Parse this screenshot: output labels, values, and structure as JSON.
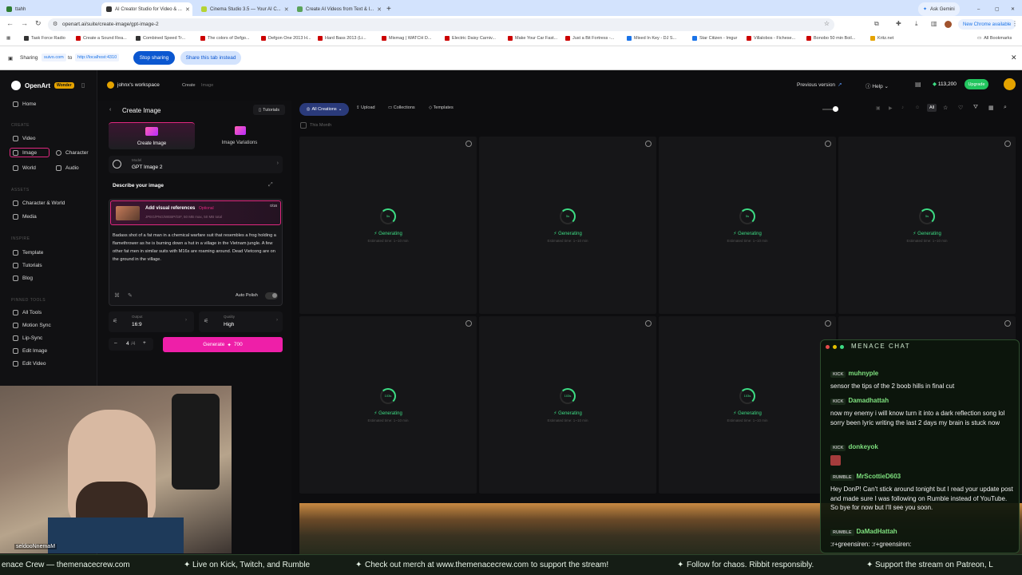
{
  "browser": {
    "tabs": [
      {
        "title": "ttahh",
        "active": false
      },
      {
        "title": "AI Creator Studio for Video & ...",
        "active": true
      },
      {
        "title": "Cinema Studio 3.5 — Your AI C...",
        "active": false
      },
      {
        "title": "Create AI Videos from Text & I...",
        "active": false
      }
    ],
    "ask_gemini": "Ask Gemini",
    "url": "openart.ai/suite/create-image/gpt-image-2",
    "new_chrome": "New Chrome available",
    "bookmarks": [
      "Task Force Radio",
      "Create a Sound Rea...",
      "Combined Speed Tr...",
      "The colors of Defgo...",
      "Defgon One 2013 H...",
      "Hard Bass 2013 (Li...",
      "Mixmag | WATCH D...",
      "Electric Daisy Carniv...",
      "Make Your Car Fast...",
      "Just a Bit Fortress -...",
      "Mixed In Key - DJ S...",
      "Star Citizen - Imgur",
      "Villalobos - Fichese...",
      "Bonobo 50 min Boil...",
      "Kritz.net"
    ],
    "all_bookmarks": "All Bookmarks",
    "sharing": {
      "label": "Sharing",
      "source": "suivo.com",
      "to": "to",
      "target": "http://localhost:4310",
      "stop": "Stop sharing",
      "share_tab": "Share this tab instead"
    }
  },
  "app": {
    "brand": "OpenArt",
    "badge": "Wonder",
    "nav": {
      "home": "Home",
      "create_label": "CREATE",
      "video": "Video",
      "image": "Image",
      "character": "Character",
      "world": "World",
      "audio": "Audio",
      "assets_label": "ASSETS",
      "char_world": "Character & World",
      "media": "Media",
      "inspire_label": "INSPIRE",
      "template": "Template",
      "tutorials": "Tutorials",
      "blog": "Blog",
      "pinned_label": "PINNED TOOLS",
      "all_tools": "All Tools",
      "motion_sync": "Motion Sync",
      "lip_sync": "Lip-Sync",
      "edit_image": "Edit Image",
      "edit_video": "Edit Video"
    },
    "workspace": "johnx's workspace",
    "breadcrumb": [
      "Create",
      "Image"
    ],
    "prev_version": "Previous version",
    "help": "Help",
    "credits": "113,200",
    "upgrade": "Upgrade",
    "panel": {
      "title": "Create Image",
      "tutorials": "Tutorials",
      "mode_create": "Create Image",
      "mode_variations": "Image Variations",
      "model_label": "Model",
      "model_name": "GPT Image 2",
      "describe": "Describe your image",
      "visual_refs": "Add visual references",
      "optional": "Optional",
      "refs_count": "0/16",
      "refs_formats": "JPEG/PNG/WEBP/GIF, 50 MB max, 50 MB total",
      "prompt": "Badass shot of a fat man in a chemical warfare suit that resembles a frog holding a flamethrower as he is burning down a hut in a village in the Vietnam jungle. A few other fat men in similar suits with M16s are roaming around. Dead Vietcong are on the ground in the village.",
      "auto_polish": "Auto Polish",
      "output_label": "Output",
      "output_value": "16:9",
      "quality_label": "Quality",
      "quality_value": "High",
      "count": "4",
      "count_max": "/4",
      "generate": "Generate",
      "generate_cost": "700"
    },
    "filters": {
      "all_creations": "All Creations",
      "upload": "Upload",
      "collections": "Collections",
      "templates": "Templates",
      "all": "All"
    },
    "this_month": "This Month",
    "cards": [
      {
        "timer": "5s",
        "status": "Generating",
        "est": "Estimated time: 1~10 min"
      },
      {
        "timer": "5s",
        "status": "Generating",
        "est": "Estimated time: 1~10 min"
      },
      {
        "timer": "5s",
        "status": "Generating",
        "est": "Estimated time: 1~10 min"
      },
      {
        "timer": "5s",
        "status": "Generating",
        "est": "Estimated time: 1~10 min"
      },
      {
        "timer": "103s",
        "status": "Generating",
        "est": "Estimated time: 1~10 min"
      },
      {
        "timer": "103s",
        "status": "Generating",
        "est": "Estimated time: 1~10 min"
      },
      {
        "timer": "103s",
        "status": "Generating",
        "est": "Estimated time: 1~10 min"
      }
    ]
  },
  "stream": {
    "cam_name": "seldooNnemaM",
    "chat_title": "MENACE CHAT",
    "messages": [
      {
        "platform": "KICK",
        "user": "muhnyple",
        "text": "sensor the tips of the 2 boob hills in final cut"
      },
      {
        "platform": "KICK",
        "user": "Damadhattah",
        "text": "now my enemy i will know turn it into a dark reflection song lol sorry been lyric writing the last 2 days my brain is stuck now"
      },
      {
        "platform": "KICK",
        "user": "donkeyok",
        "text": ""
      },
      {
        "platform": "RUMBLE",
        "user": "MrScottieD603",
        "text": "Hey DonP! Can't stick around tonight but I read your update post and made sure I was following on Rumble instead of YouTube. So bye for now but I'll see you soon."
      },
      {
        "platform": "RUMBLE",
        "user": "DaMadHattah",
        "text": ":r+greensiren: :r+greensiren:"
      }
    ],
    "ticker": [
      "enace Crew — themenacecrew.com",
      "Live on Kick, Twitch, and Rumble",
      "Check out merch at www.themenacecrew.com to support the stream!",
      "Follow for chaos. Ribbit responsibly.",
      "Support the stream on Patreon, L"
    ]
  },
  "colors": {
    "accent": "#e0287f",
    "generating": "#3ddc84",
    "upgrade": "#22c55e",
    "chat_name": "#7ee07e"
  }
}
